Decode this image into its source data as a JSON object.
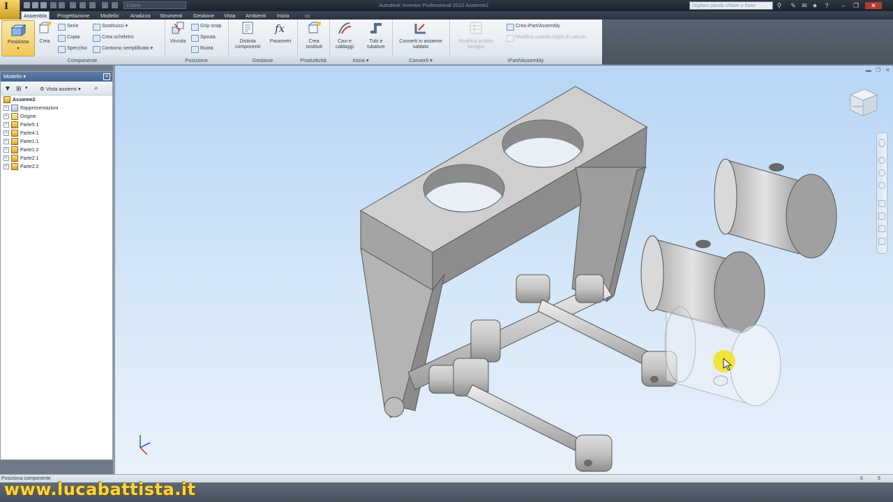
{
  "app": {
    "icon_letter": "I",
    "window_title": "Autodesk Inventor Professional 2010     Assieme2",
    "color_select": "Colore",
    "search_placeholder": "Digitare parola chiave o frase"
  },
  "tabs": [
    "Assembla",
    "Progettazione",
    "Modello",
    "Analizza",
    "Strumenti",
    "Gestione",
    "Vista",
    "Ambienti",
    "Inizia"
  ],
  "active_tab": "Assembla",
  "ribbon": {
    "componente": {
      "label": "Componente",
      "posiziona": "Posiziona",
      "crea": "Crea",
      "serie": "Serie",
      "copia": "Copia",
      "specchio": "Specchio",
      "sostituisci": "Sostituisci",
      "crea_scheletro": "Crea scheletro",
      "contorno_semplificato": "Contorno semplificato"
    },
    "posizione": {
      "label": "Posizione",
      "vincola": "Vincola",
      "grip_snap": "Grip snap",
      "sposta": "Sposta",
      "ruota": "Ruota"
    },
    "gestione": {
      "label": "Gestione",
      "distinta_1": "Distinta",
      "distinta_2": "componenti",
      "parametri": "Parametri"
    },
    "produttivita": {
      "label": "Produttività",
      "crea_1": "Crea",
      "crea_2": "sostituti"
    },
    "inizia": {
      "label": "Inizia",
      "cavi_1": "Cavi e",
      "cavi_2": "cablaggi",
      "tubi_1": "Tubi e",
      "tubi_2": "tubature"
    },
    "converti": {
      "label": "Converti",
      "converti_1": "Converti in assieme",
      "converti_2": "saldato"
    },
    "ipart": {
      "label": "iPart/iAssembly",
      "modifica_1": "Modifica ambito",
      "modifica_2": "famiglia",
      "crea_ipart": "Crea iPart/Assembly",
      "modifica_foglio": "Modifica usando foglio di calcolo"
    }
  },
  "browser": {
    "title": "Modello",
    "view_select": "Vista assiemi",
    "root": "Assieme2",
    "items": [
      "Rappresentazioni",
      "Origine",
      "Parte5:1",
      "Parte4:1",
      "Parte1:1",
      "Parte1:2",
      "Parte2:1",
      "Parte2:2"
    ]
  },
  "viewcube": {
    "face_label": "DAVANTI"
  },
  "status": {
    "text": "Posiziona componente",
    "count_1": "6",
    "count_2": "5"
  },
  "watermark": "www.lucabattista.it",
  "colors": {
    "accent_yellow": "#f3c85a",
    "viewport_top": "#b7d5f5",
    "viewport_bottom": "#e9f1fa",
    "part_grey": "#b9b9b9",
    "highlight": "#f4e21c"
  }
}
